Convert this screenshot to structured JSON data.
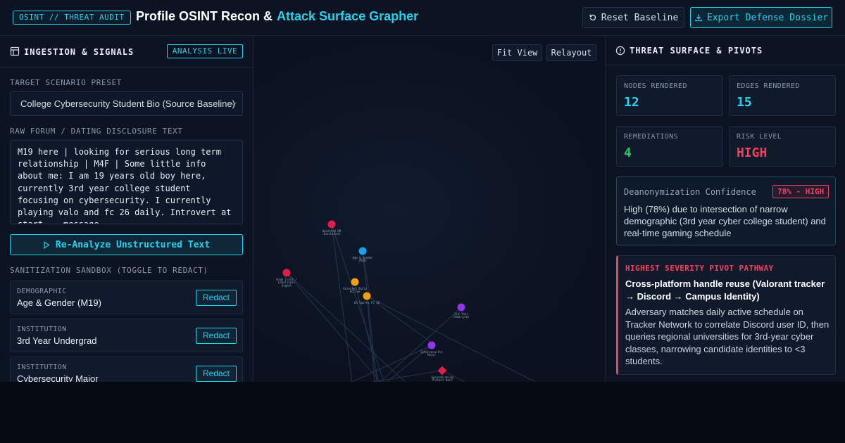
{
  "header": {
    "badge": "OSINT // THREAT AUDIT",
    "title_main": "Profile OSINT Recon &",
    "title_accent": "Attack Surface Grapher",
    "reset_label": "Reset Baseline",
    "export_label": "Export Defense Dossier"
  },
  "left_panel": {
    "title": "INGESTION & SIGNALS",
    "status_badge": "ANALYSIS LIVE",
    "preset_label": "TARGET SCENARIO PRESET",
    "preset_value": "College Cybersecurity Student Bio (Source Baseline)",
    "raw_label": "RAW FORUM / DATING DISCLOSURE TEXT",
    "raw_text": "M19 here | looking for serious long term relationship | M4F | Some little info about me: I am 19 years old boy here, currently 3rd year college student focusing on cybersecurity. I currently playing valo and fc 26 daily. Introvert at start... message",
    "analyze_label": "Re-Analyze Unstructured Text",
    "sandbox_label": "SANITIZATION SANDBOX (TOGGLE TO REDACT)",
    "cards": [
      {
        "category": "DEMOGRAPHIC",
        "value": "Age & Gender (M19)",
        "action": "Redact"
      },
      {
        "category": "INSTITUTION",
        "value": "3rd Year Undergrad",
        "action": "Redact"
      },
      {
        "category": "INSTITUTION",
        "value": "Cybersecurity Major",
        "action": "Redact"
      }
    ]
  },
  "graph": {
    "fit_label": "Fit View",
    "relayout_label": "Relayout",
    "nodes": [
      {
        "id": "n1",
        "label": [
          "Unvetted DM",
          "Invitation"
        ],
        "color": "#e11d48",
        "shape": "circle"
      },
      {
        "id": "n2",
        "label": [
          "Age & Gender",
          "(M19)"
        ],
        "color": "#0ea5e9",
        "shape": "circle"
      },
      {
        "id": "n3",
        "label": [
          "High Trust /",
          "Loneliness",
          "Signal"
        ],
        "color": "#e11d48",
        "shape": "circle"
      },
      {
        "id": "n4",
        "label": [
          "Valorant Daily",
          "Active"
        ],
        "color": "#f59e0b",
        "shape": "circle"
      },
      {
        "id": "n5",
        "label": [
          "EA Sports FC 26"
        ],
        "color": "#f59e0b",
        "shape": "circle"
      },
      {
        "id": "n6",
        "label": [
          "3rd Year",
          "Undergrad"
        ],
        "color": "#9333ea",
        "shape": "circle"
      },
      {
        "id": "n7",
        "label": [
          "Cybersecurity",
          "Major"
        ],
        "color": "#9333ea",
        "shape": "circle"
      },
      {
        "id": "n8",
        "label": [
          "Spearphishing",
          "Pretext Bait"
        ],
        "color": "#e11d48",
        "shape": "diamond"
      }
    ]
  },
  "right_panel": {
    "title": "THREAT SURFACE & PIVOTS",
    "stats": [
      {
        "label": "NODES RENDERED",
        "value": "12",
        "color": "#22d3ee"
      },
      {
        "label": "EDGES RENDERED",
        "value": "15",
        "color": "#22d3ee"
      },
      {
        "label": "REMEDIATIONS",
        "value": "4",
        "color": "#22c55e"
      },
      {
        "label": "RISK LEVEL",
        "value": "HIGH",
        "color": "#f43f5e"
      }
    ],
    "confidence_label": "Deanonymization Confidence",
    "confidence_badge": "78% - HIGH",
    "confidence_desc": "High (78%) due to intersection of narrow demographic (3rd year cyber college student) and real-time gaming schedule",
    "pivot_title": "HIGHEST SEVERITY PIVOT PATHWAY",
    "pivot_path": "Cross-platform handle reuse (Valorant tracker → Discord → Campus Identity)",
    "pivot_body": "Adversary matches daily active schedule on Tracker Network to correlate Discord user ID, then queries regional universities for 3rd-year cyber classes, narrowing candidate identities to <3 students."
  }
}
